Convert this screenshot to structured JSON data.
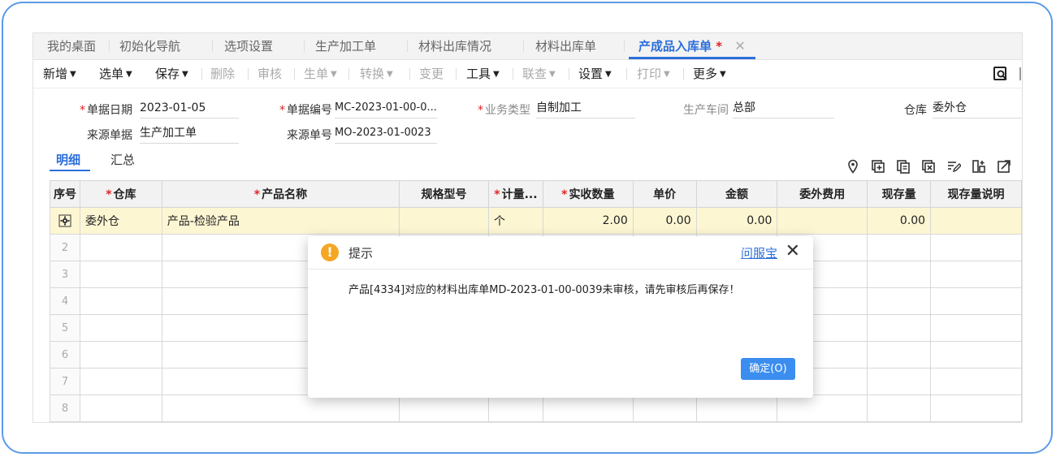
{
  "tabs": [
    {
      "label": "我的桌面"
    },
    {
      "label": "初始化导航"
    },
    {
      "label": "选项设置"
    },
    {
      "label": "生产加工单"
    },
    {
      "label": "材料出库情况"
    },
    {
      "label": "材料出库单"
    },
    {
      "label": "产成品入库单",
      "modified": "*",
      "close": "✕"
    }
  ],
  "toolbar": {
    "new": "新增",
    "select_doc": "选单",
    "save": "保存",
    "delete": "删除",
    "audit": "审核",
    "gen_doc": "生单",
    "convert": "转换",
    "change": "变更",
    "tools": "工具",
    "query": "联查",
    "settings": "设置",
    "print": "打印",
    "more": "更多",
    "dropdown_arrow": "▼"
  },
  "form": {
    "req_mark": "*",
    "doc_date_label": "单据日期",
    "doc_date": "2023-01-05",
    "doc_no_label": "单据编号",
    "doc_no": "MC-2023-01-00-0...",
    "biz_type_label": "业务类型",
    "biz_type": "自制加工",
    "workshop_label": "生产车间",
    "workshop": "总部",
    "warehouse_label": "仓库",
    "warehouse": "委外仓",
    "source_doc_label": "来源单据",
    "source_doc": "生产加工单",
    "source_no_label": "来源单号",
    "source_no": "MO-2023-01-0023"
  },
  "detail_tabs": {
    "detail": "明细",
    "summary": "汇总"
  },
  "grid": {
    "headers": {
      "seq": "序号",
      "warehouse": "仓库",
      "product": "产品名称",
      "spec": "规格型号",
      "unit": "计量...",
      "qty": "实收数量",
      "price": "单价",
      "amount": "金额",
      "outsource_fee": "委外费用",
      "stock": "现存量",
      "stock_note": "现存量说明"
    },
    "rows": [
      {
        "seq": "",
        "warehouse": "委外仓",
        "product": "产品-检验产品",
        "spec": "",
        "unit": "个",
        "qty": "2.00",
        "price": "0.00",
        "amount": "0.00",
        "outsource_fee": "",
        "stock": "0.00",
        "stock_note": ""
      }
    ],
    "empty_rows": [
      "2",
      "3",
      "4",
      "5",
      "6",
      "7",
      "8"
    ]
  },
  "dialog": {
    "icon": "!",
    "title": "提示",
    "help_link": "问服宝",
    "close": "✕",
    "message": "产品[4334]对应的材料出库单MD-2023-01-00-0039未审核，请先审核后再保存！",
    "ok_button": "确定(O)"
  }
}
